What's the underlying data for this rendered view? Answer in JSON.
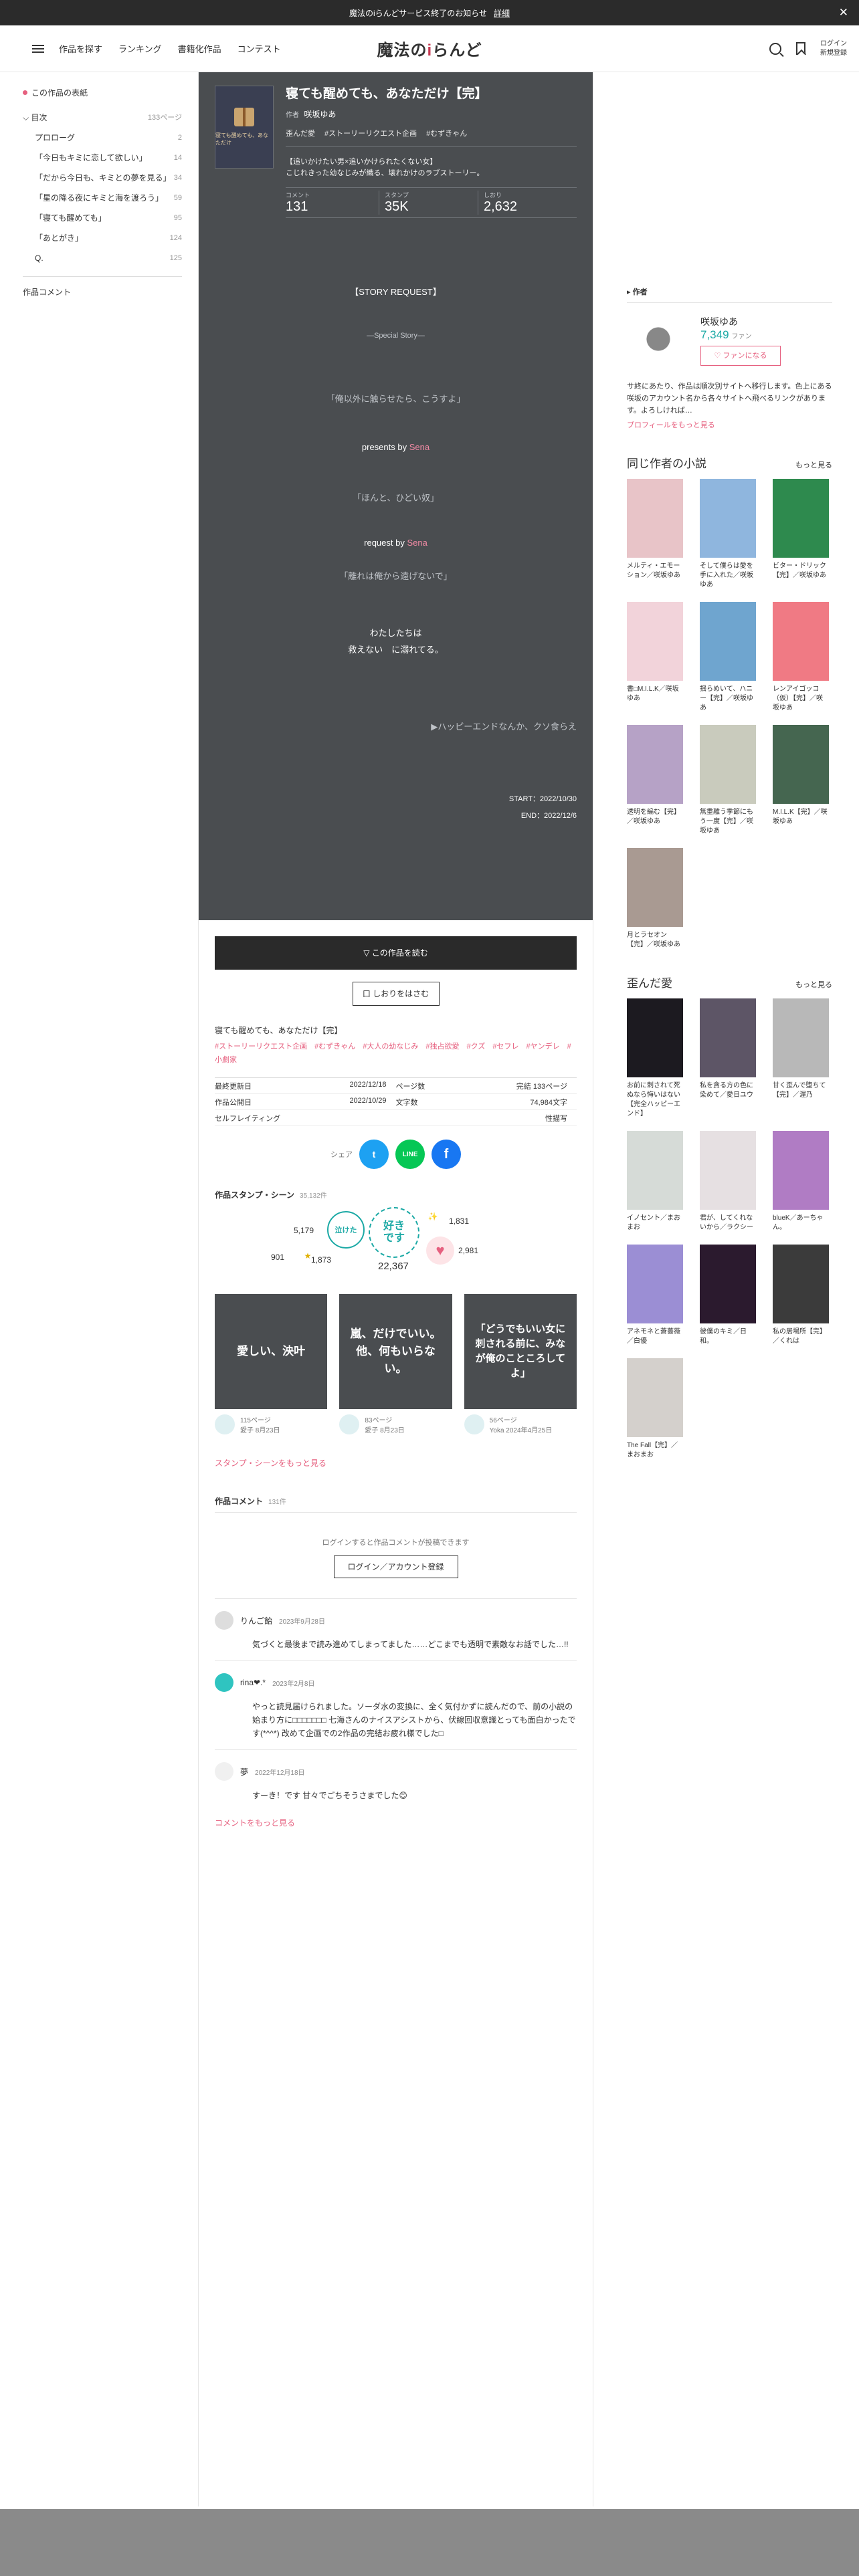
{
  "announce": {
    "text": "魔法のiらんどサービス終了のお知らせ",
    "link": "詳細",
    "close": "✕"
  },
  "header": {
    "nav": [
      "作品を探す",
      "ランキング",
      "書籍化作品",
      "コンテスト"
    ],
    "logo_pre": "魔法の",
    "logo_i": "i",
    "logo_post": "らんど",
    "login_line1": "ログイン",
    "login_line2": "新規登録"
  },
  "toc": {
    "title": "この作品の表紙",
    "chapter_head": "目次",
    "total_pages": "133ページ",
    "items": [
      {
        "title": "プロローグ",
        "page": "2"
      },
      {
        "title": "「今日もキミに恋して欲しい」",
        "page": "14"
      },
      {
        "title": "「だから今日も、キミとの夢を見る」",
        "page": "34"
      },
      {
        "title": "「星の降る夜にキミと海を渡ろう」",
        "page": "59"
      },
      {
        "title": "「寝ても醒めても」",
        "page": "95"
      },
      {
        "title": "「あとがき」",
        "page": "124"
      },
      {
        "title": "Q.",
        "page": "125"
      }
    ],
    "comments": "作品コメント"
  },
  "book": {
    "cover_text": "寝ても醒めても、あなただけ",
    "title": "寝ても醒めても、あなただけ【完】",
    "author_label": "作者",
    "author": "咲坂ゆあ",
    "tags": [
      "歪んだ愛",
      "#ストーリーリクエスト企画",
      "#むずきゃん"
    ],
    "blurb_line1": "【追いかけたい男×追いかけられたくない女】",
    "blurb_line2": "こじれきった幼なじみが織る、壊れかけのラブストーリー。",
    "stats": [
      {
        "key": "コメント",
        "value": "131"
      },
      {
        "key": "スタンプ",
        "value": "35K"
      },
      {
        "key": "しおり",
        "value": "2,632"
      }
    ]
  },
  "story": {
    "l1": "【STORY REQUEST】",
    "l2": "—Special Story—",
    "l3": "「俺以外に触らせたら、こうすよ」",
    "l4a": "presents by ",
    "l4b": "Sena",
    "l5": "「ほんと、ひどい奴」",
    "l6a": "request by ",
    "l6b": "Sena",
    "l7": "「離れは俺から遠げないで」",
    "l8": "わたしたちは",
    "l9": "救えない　に溺れてる。",
    "l10": "▶ハッピーエンドなんか、クソ食らえ",
    "start": "START：2022/10/30",
    "end": "END：2022/12/6"
  },
  "actions": {
    "read": "▽ この作品を読む",
    "bookmark": "口 しおりをはさむ"
  },
  "detail": {
    "title": "寝ても醒めても、あなただけ【完】",
    "tags": "#ストーリーリクエスト企画　#むずきゃん　#大人の幼なじみ　#独占欲愛　#クズ　#セフレ　#ヤンデレ　#小劇家",
    "meta": [
      {
        "k1": "最終更新日",
        "v1": "2022/12/18",
        "k2": "ページ数",
        "v2": "完結 133ページ"
      },
      {
        "k1": "作品公開日",
        "v1": "2022/10/29",
        "k2": "文字数",
        "v2": "74,984文字"
      },
      {
        "k1": "セルフレイティング",
        "v1": "",
        "k2": "",
        "v2": "性描写"
      }
    ],
    "share_label": "シェア"
  },
  "stamps": {
    "title": "作品スタンプ・シーン",
    "count": "35,132件",
    "c1": "5,179",
    "c2": "1,831",
    "c3": "901",
    "c4": "1,873",
    "c5": "2,981",
    "main_text1": "好き",
    "main_text2": "です",
    "main_count": "22,367",
    "small_text": "泣けた"
  },
  "scenes": [
    {
      "quote": "愛しい、泱叶",
      "page": "115ページ",
      "by": "愛子 8月23日"
    },
    {
      "quote": "嵐、だけでいい。他、何もいらない。",
      "page": "83ページ",
      "by": "愛子 8月23日"
    },
    {
      "quote": "「どうでもいい女に刺される前に、みなが俺のこところして よ」",
      "page": "56ページ",
      "by": "Yoka 2024年4月25日"
    }
  ],
  "more_stamps": "スタンプ・シーンをもっと見る",
  "comments": {
    "title": "作品コメント",
    "count": "131件",
    "login_note": "ログインすると作品コメントが投稿できます",
    "login_btn": "ログイン／アカウント登録",
    "items": [
      {
        "name": "りんご飴",
        "date": "2023年9月28日",
        "body": "気づくと最後まで読み進めてしまってました……どこまでも透明で素敵なお話でした…!!"
      },
      {
        "name": "rina❤︎.*",
        "date": "2023年2月8日",
        "body": "やっと読見届けられました。ソーダ水の変換に、全く気付かずに読んだので、前の小説の始まり方に□□□□□□□ 七海さんのナイスアシストから、伏線回収意識とっても面白かったです(*^^*) 改めて企画での2作品の完結お疲れ様でした□"
      },
      {
        "name": "夢",
        "date": "2022年12月18日",
        "body": "すーき！です 甘々でごちそうさまでした😊"
      }
    ],
    "more": "コメントをもっと見る"
  },
  "right": {
    "author_head": "作者",
    "author_name": "咲坂ゆあ",
    "fans": "7,349",
    "fans_label": "ファン",
    "fan_btn": "♡ ファンになる",
    "desc": "サ終にあたり、作品は順次別サイトへ移行します。色上にある咲坂のアカウント名から各々サイトへ飛べるリンクがあります。よろしければ…",
    "profile_more": "プロフィールをもっと見る",
    "same_author": "同じ作者の小説",
    "same_more": "もっと見る",
    "books": [
      {
        "t": "メルティ・エモーション／咲坂ゆあ",
        "c": "#e8c4c8"
      },
      {
        "t": "そして僕らは愛を手に入れた／咲坂ゆあ",
        "c": "#8fb6de"
      },
      {
        "t": "ビター・ドリック【完】／咲坂ゆあ",
        "c": "#2e8a4e"
      },
      {
        "t": "書□M.I.L.K／咲坂ゆあ",
        "c": "#f2d3da"
      },
      {
        "t": "揺らめいて、ハニー【完】／咲坂ゆあ",
        "c": "#6fa5cf"
      },
      {
        "t": "レンアイゴッコ（仮）【完】／咲坂ゆあ",
        "c": "#f07a84"
      },
      {
        "t": "透明を編む【完】／咲坂ゆあ",
        "c": "#b6a2c6"
      },
      {
        "t": "無重離う季節にもう一度【完】／咲坂ゆあ",
        "c": "#c9cbbd"
      },
      {
        "t": "M.I.L.K【完】／咲坂ゆあ",
        "c": "#456650"
      },
      {
        "t": "月とラセオン【完】／咲坂ゆあ",
        "c": "#a99a92"
      }
    ],
    "twisted": "歪んだ愛",
    "twisted_more": "もっと見る",
    "twisted_books": [
      {
        "t": "お前に刺されて死ぬなら悔いはない【完全ハッピーエンド】",
        "c": "#1c1a20"
      },
      {
        "t": "私を貪る方の色に染めて／愛日ユウ",
        "c": "#5d5566"
      },
      {
        "t": "甘く歪んで堕ちて【完】／渥乃",
        "c": "#b8b8b8"
      },
      {
        "t": "イノセント／まおまお",
        "c": "#d6dbd7"
      },
      {
        "t": "君が、してくれないから／ラクシー",
        "c": "#e6e0e2"
      },
      {
        "t": "blueK／あーちゃん。",
        "c": "#b07cc4"
      },
      {
        "t": "アネモネと蒼薔薇／白優",
        "c": "#9b8ed4"
      },
      {
        "t": "彼僕のキミ／日和。",
        "c": "#2b1a2e"
      },
      {
        "t": "私の居場所【完】／くれは",
        "c": "#3b3b3b"
      },
      {
        "t": "The Fall【完】／まおまお",
        "c": "#d4d0cc"
      }
    ]
  },
  "colors": {
    "accent": "#e6607f",
    "dark_panel": "#4a4d50",
    "teal": "#1ba9a5"
  }
}
